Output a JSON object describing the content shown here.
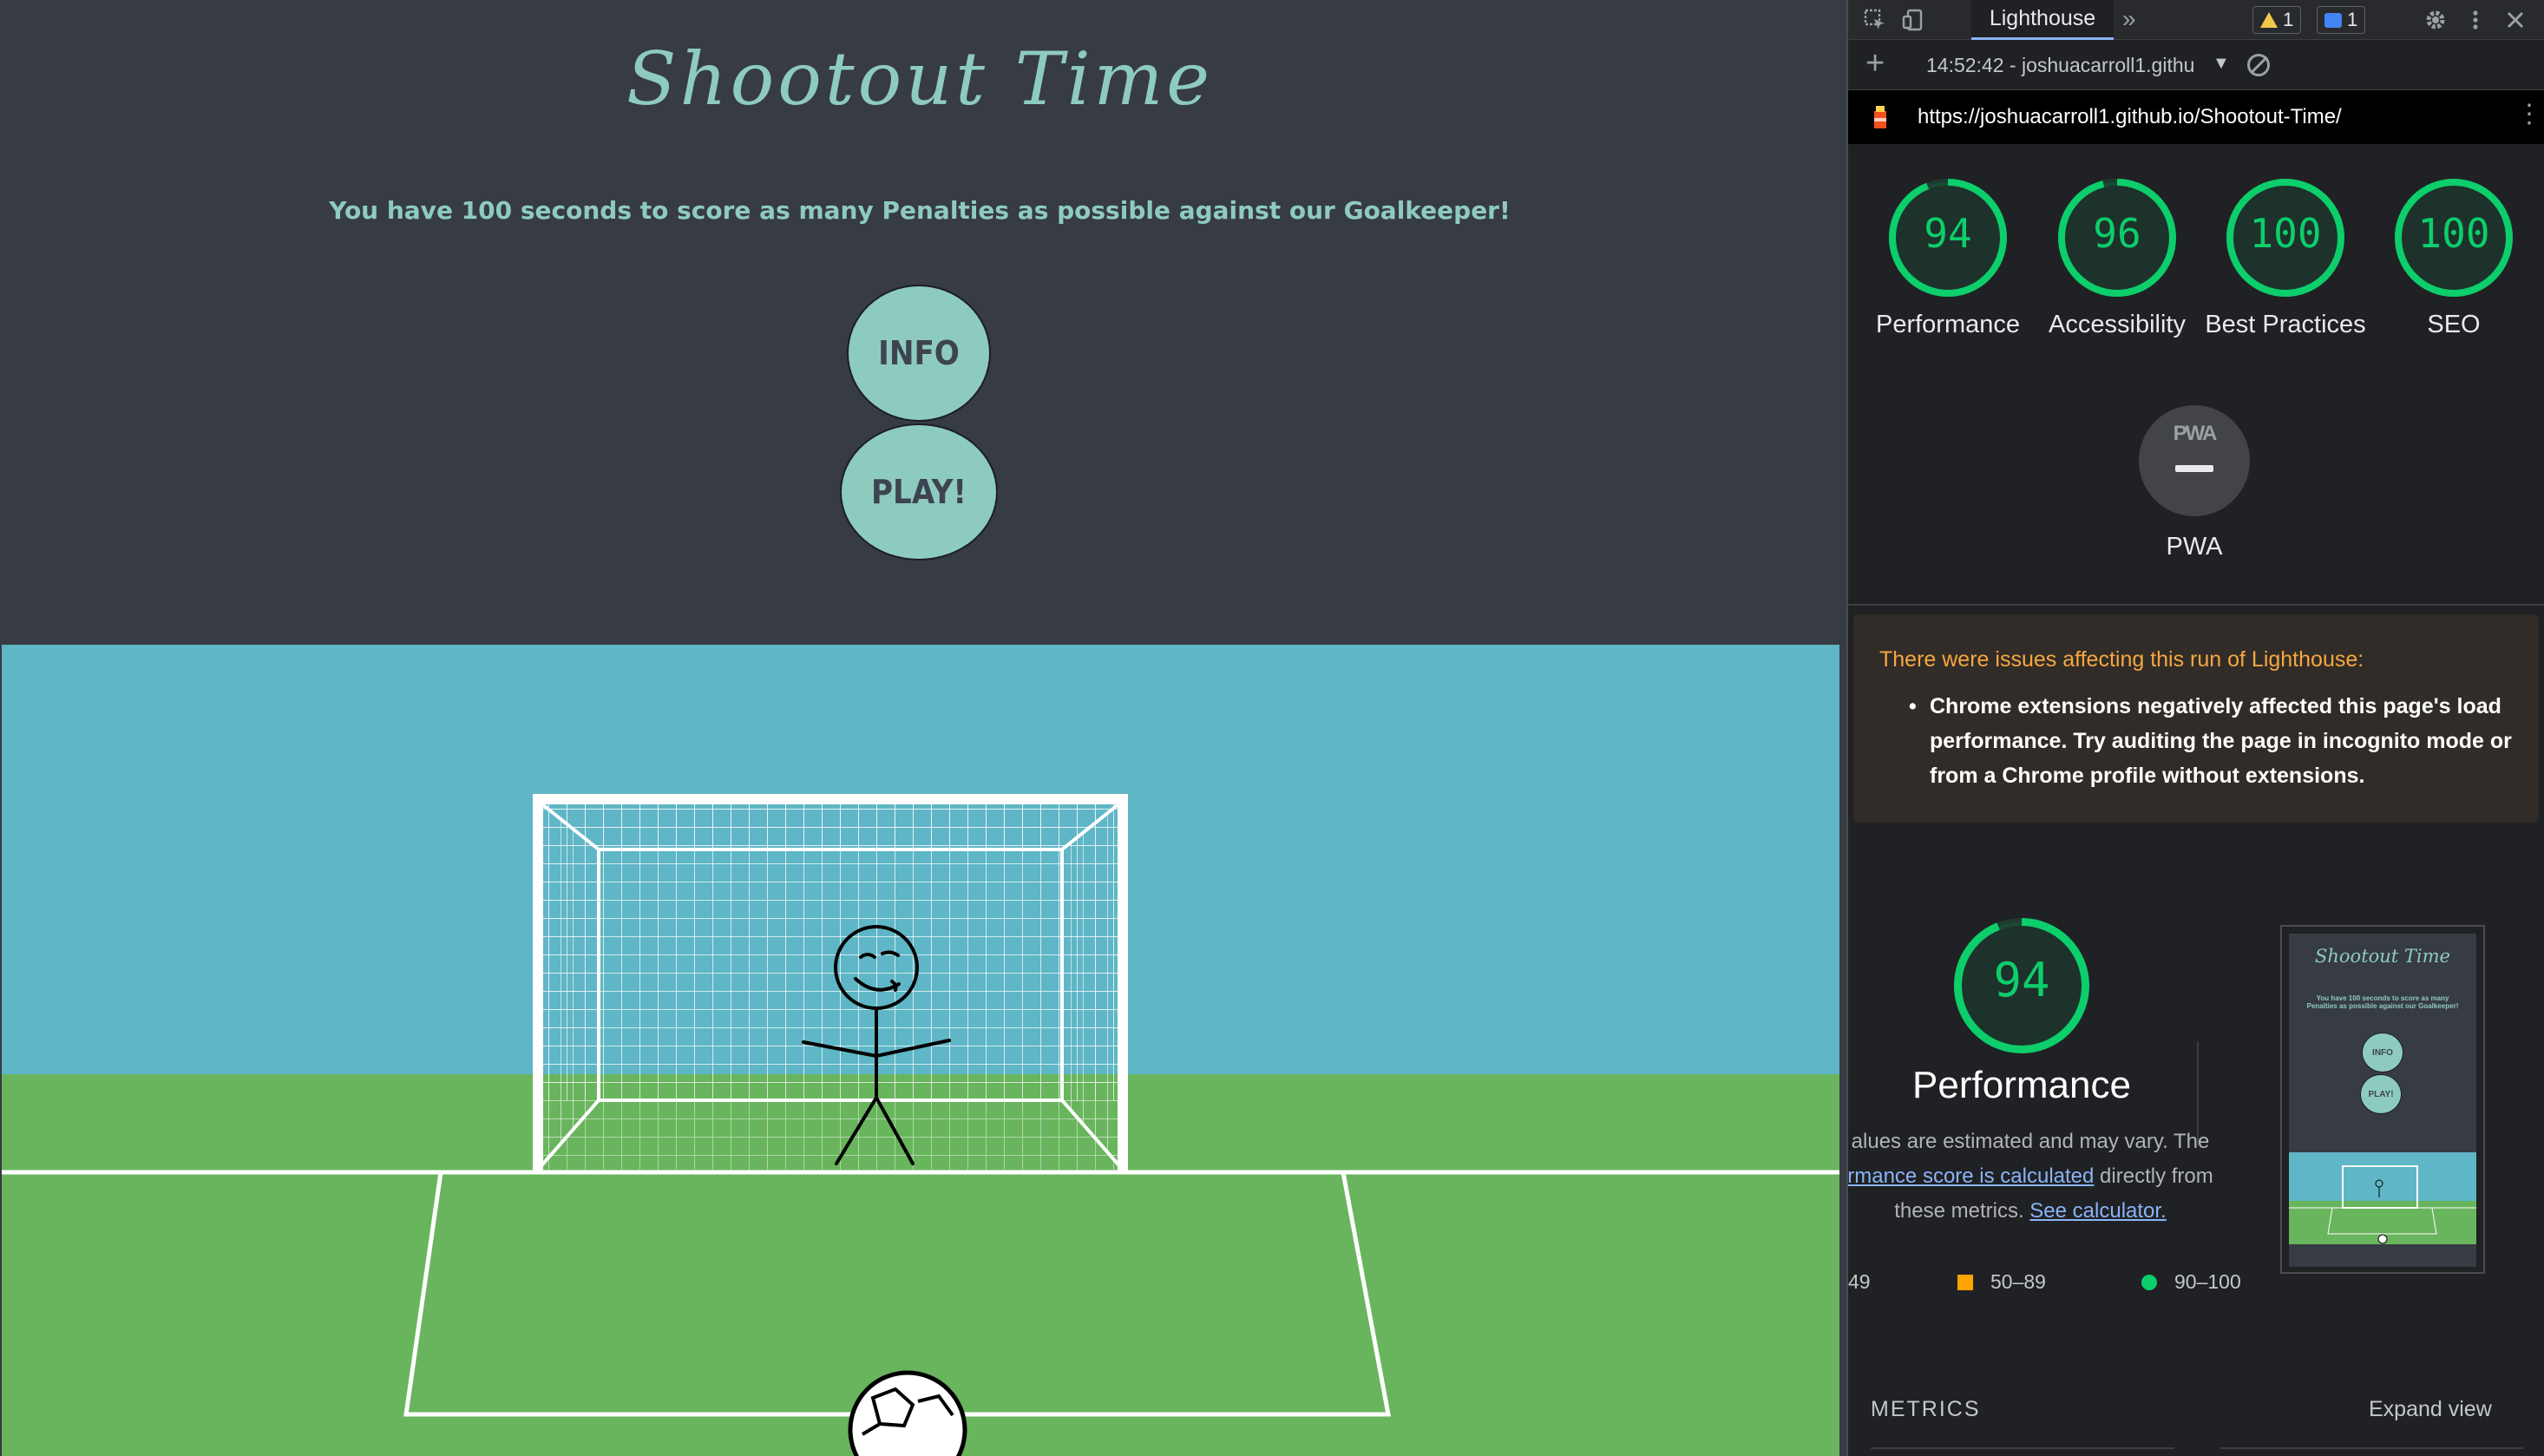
{
  "game": {
    "title": "Shootout Time",
    "subtitle": "You have 100 seconds to score as many Penalties as possible against our Goalkeeper!",
    "info_label": "INFO",
    "play_label": "PLAY!"
  },
  "devtools": {
    "toolbar": {
      "active_tab": "Lighthouse",
      "more_tabs": "»",
      "warning_count": "1",
      "message_count": "1"
    },
    "report_select": "14:52:42 - joshuacarroll1.githu",
    "url": "https://joshuacarroll1.github.io/Shootout-Time/",
    "scores": [
      {
        "label": "Performance",
        "value": "94",
        "score": 94
      },
      {
        "label": "Accessibility",
        "value": "96",
        "score": 96
      },
      {
        "label": "Best Practices",
        "value": "100",
        "score": 100
      },
      {
        "label": "SEO",
        "value": "100",
        "score": 100
      }
    ],
    "pwa": {
      "label": "PWA",
      "badge_text": "PWA"
    },
    "warnings": {
      "title": "There were issues affecting this run of Lighthouse:",
      "items": [
        "Chrome extensions negatively affected this page's load performance. Try auditing the page in incognito mode or from a Chrome profile without extensions."
      ]
    },
    "performance": {
      "score": "94",
      "title": "Performance",
      "desc_1": "alues are estimated and may vary. The",
      "desc_link_1": "rmance score is calculated",
      "desc_2": " directly from",
      "desc_3": "these metrics. ",
      "desc_link_2": "See calculator."
    },
    "legend": {
      "fail": "49",
      "average": "50–89",
      "pass": "90–100"
    },
    "thumbnail": {
      "title": "Shootout Time",
      "subtitle": "You have 100 seconds to score as many Penalties as possible against our Goalkeeper!",
      "info_label": "INFO",
      "play_label": "PLAY!"
    },
    "metrics": {
      "title": "METRICS",
      "expand": "Expand view"
    }
  },
  "colors": {
    "pass": "#0cce6b",
    "warning_text": "#f7a741",
    "accent": "#8ecbbf",
    "sky": "#5fb6c6",
    "grass": "#69b55d"
  }
}
